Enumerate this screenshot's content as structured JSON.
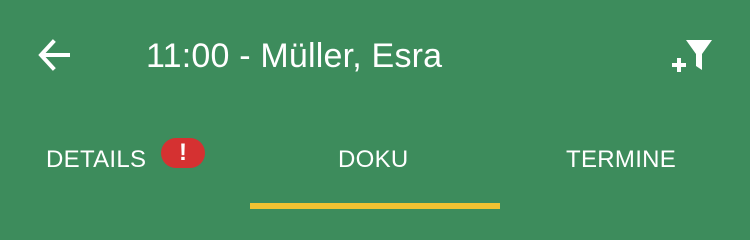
{
  "header": {
    "title": "11:00 - Müller, Esra",
    "back_icon": "arrow-left-icon",
    "filter_icon": "filter-add-icon"
  },
  "tabs": [
    {
      "label": "DETAILS",
      "badge": "!",
      "selected": false
    },
    {
      "label": "DOKU",
      "selected": true
    },
    {
      "label": "TERMINE",
      "selected": false
    }
  ],
  "colors": {
    "background": "#3d8c5c",
    "indicator": "#f2c232",
    "badge": "#d53131",
    "text": "#ffffff"
  }
}
